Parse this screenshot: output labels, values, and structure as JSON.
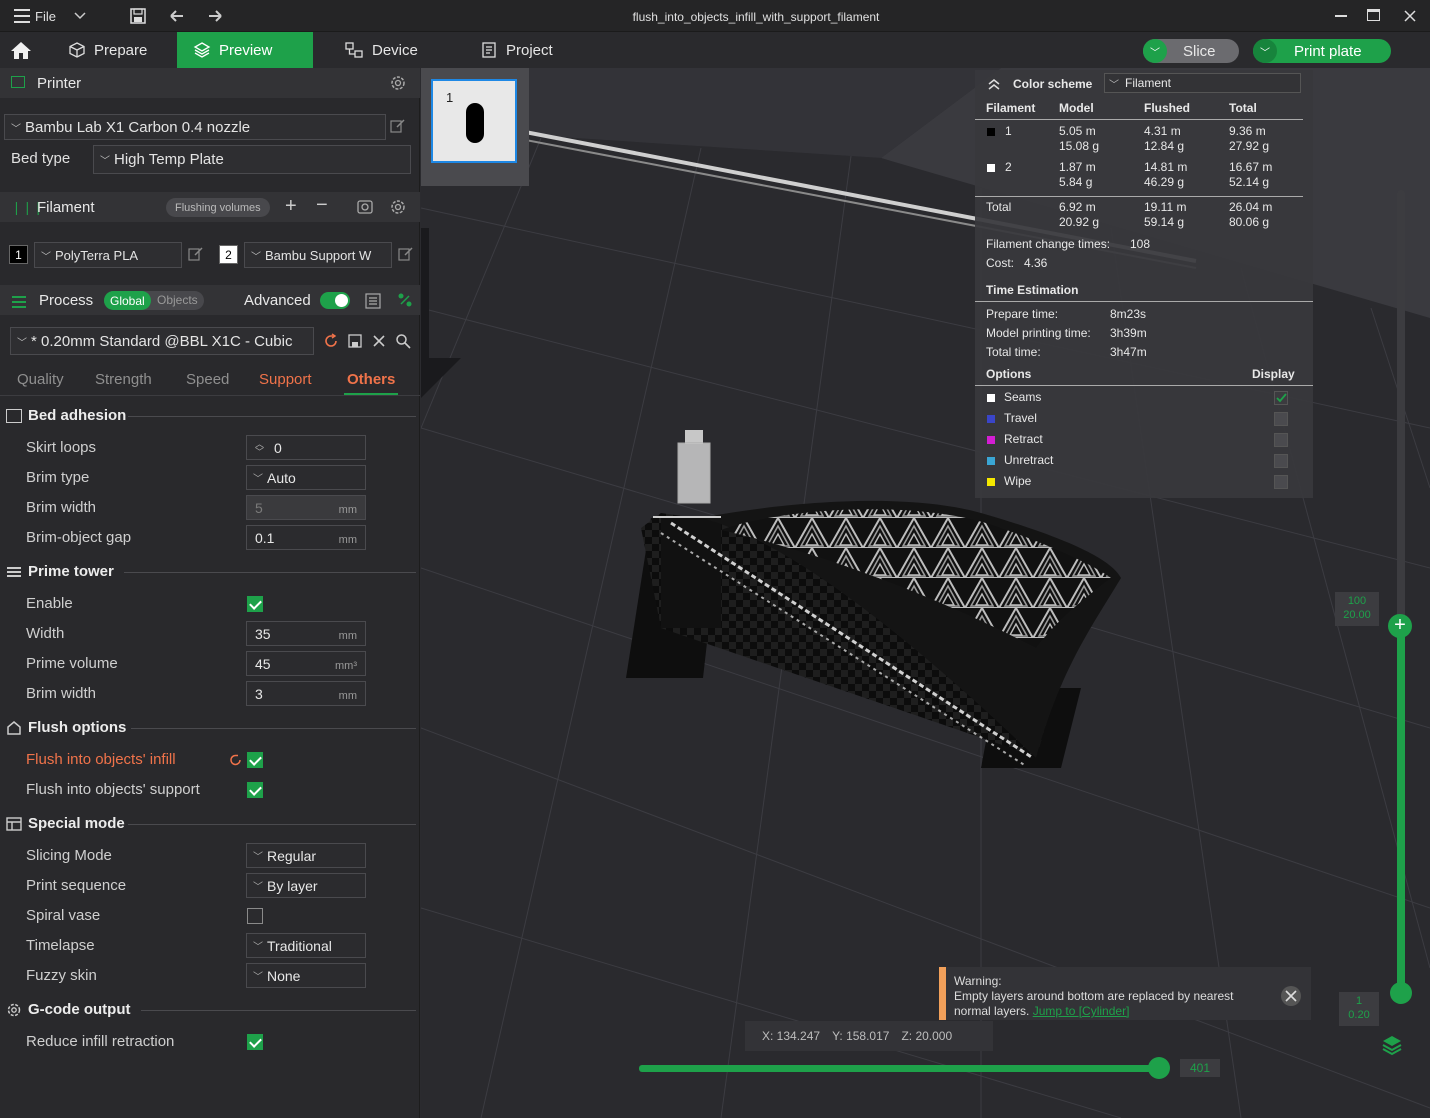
{
  "window": {
    "title": "flush_into_objects_infill_with_support_filament",
    "file_menu": "File"
  },
  "nav": {
    "tabs": [
      "Prepare",
      "Preview",
      "Device",
      "Project"
    ],
    "active": "Preview",
    "slice": "Slice",
    "print": "Print plate"
  },
  "printer": {
    "section": "Printer",
    "name": "Bambu Lab X1 Carbon 0.4 nozzle",
    "bed_type_label": "Bed type",
    "bed_type": "High Temp Plate"
  },
  "filament": {
    "section": "Filament",
    "flushing": "Flushing volumes",
    "items": [
      {
        "num": "1",
        "name": "PolyTerra PLA"
      },
      {
        "num": "2",
        "name": "Bambu Support W"
      }
    ]
  },
  "process": {
    "section": "Process",
    "global": "Global",
    "objects": "Objects",
    "advanced": "Advanced",
    "preset": "* 0.20mm Standard @BBL X1C - Cubic",
    "tabs": [
      "Quality",
      "Strength",
      "Speed",
      "Support",
      "Others"
    ],
    "active_tab": "Others"
  },
  "groups": {
    "bed_adhesion": "Bed adhesion",
    "prime_tower": "Prime tower",
    "flush_options": "Flush options",
    "special_mode": "Special mode",
    "gcode_output": "G-code output"
  },
  "params": {
    "skirt_loops": {
      "label": "Skirt loops",
      "value": "0"
    },
    "brim_type": {
      "label": "Brim type",
      "value": "Auto"
    },
    "brim_width": {
      "label": "Brim width",
      "value": "5",
      "unit": "mm"
    },
    "brim_gap": {
      "label": "Brim-object gap",
      "value": "0.1",
      "unit": "mm"
    },
    "enable": {
      "label": "Enable",
      "checked": true
    },
    "width": {
      "label": "Width",
      "value": "35",
      "unit": "mm"
    },
    "prime_volume": {
      "label": "Prime volume",
      "value": "45",
      "unit": "mm³"
    },
    "pt_brim_width": {
      "label": "Brim width",
      "value": "3",
      "unit": "mm"
    },
    "flush_infill": {
      "label": "Flush into objects' infill",
      "checked": true
    },
    "flush_support": {
      "label": "Flush into objects' support",
      "checked": true
    },
    "slicing_mode": {
      "label": "Slicing Mode",
      "value": "Regular"
    },
    "print_sequence": {
      "label": "Print sequence",
      "value": "By layer"
    },
    "spiral_vase": {
      "label": "Spiral vase",
      "checked": false
    },
    "timelapse": {
      "label": "Timelapse",
      "value": "Traditional"
    },
    "fuzzy_skin": {
      "label": "Fuzzy skin",
      "value": "None"
    },
    "reduce_retraction": {
      "label": "Reduce infill retraction",
      "checked": true
    }
  },
  "stats": {
    "color_scheme_label": "Color scheme",
    "color_scheme": "Filament",
    "headers": [
      "Filament",
      "Model",
      "Flushed",
      "Total"
    ],
    "rows": [
      {
        "id": "1",
        "color": "#000000",
        "model_m": "5.05 m",
        "model_g": "15.08 g",
        "flushed_m": "4.31 m",
        "flushed_g": "12.84 g",
        "total_m": "9.36 m",
        "total_g": "27.92 g"
      },
      {
        "id": "2",
        "color": "#ffffff",
        "model_m": "1.87 m",
        "model_g": "5.84 g",
        "flushed_m": "14.81 m",
        "flushed_g": "46.29 g",
        "total_m": "16.67 m",
        "total_g": "52.14 g"
      }
    ],
    "total": {
      "label": "Total",
      "model_m": "6.92 m",
      "model_g": "20.92 g",
      "flushed_m": "19.11 m",
      "flushed_g": "59.14 g",
      "total_m": "26.04 m",
      "total_g": "80.06 g"
    },
    "change_times_label": "Filament change times:",
    "change_times": "108",
    "cost_label": "Cost:",
    "cost": "4.36",
    "time_title": "Time Estimation",
    "prepare_label": "Prepare time:",
    "prepare": "8m23s",
    "model_label": "Model printing time:",
    "model_time": "3h39m",
    "total_label": "Total time:",
    "total_time": "3h47m",
    "options_label": "Options",
    "display_label": "Display",
    "options": [
      {
        "name": "Seams",
        "color": "#ffffff",
        "on": true
      },
      {
        "name": "Travel",
        "color": "#3a45c8",
        "on": false
      },
      {
        "name": "Retract",
        "color": "#d41ed4",
        "on": false
      },
      {
        "name": "Unretract",
        "color": "#3aa6d4",
        "on": false
      },
      {
        "name": "Wipe",
        "color": "#f5e800",
        "on": false
      }
    ]
  },
  "plate_thumb": {
    "number": "1"
  },
  "warning": {
    "title": "Warning:",
    "line1": "Empty layers around bottom are replaced by nearest",
    "line2": "normal layers.",
    "link": "Jump to [Cylinder]"
  },
  "coords": {
    "x": "X: 134.247",
    "y": "Y: 158.017",
    "z": "Z: 20.000"
  },
  "vslider": {
    "top_layer": "100",
    "top_height": "20.00",
    "bottom_layer": "1",
    "bottom_height": "0.20"
  },
  "hslider": {
    "value": "401"
  },
  "colors": {
    "accent": "#1ea14a",
    "warning": "#f2a05a",
    "highlight": "#f0734a"
  }
}
